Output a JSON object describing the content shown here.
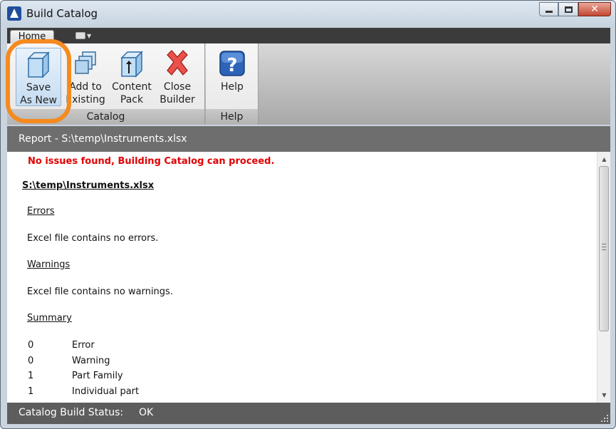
{
  "window": {
    "title": "Build Catalog",
    "controls": {
      "minimize": "minimize",
      "maximize": "maximize",
      "close": "✕"
    }
  },
  "ribbon": {
    "tabs": [
      {
        "label": "Home",
        "active": true
      }
    ],
    "quick_access": {
      "icon": "quick-access-icon"
    },
    "panels": {
      "catalog": {
        "title": "Catalog",
        "buttons": [
          {
            "line1": "Save",
            "line2": "As New",
            "icon": "save-cube-icon",
            "active": true
          },
          {
            "line1": "Add to",
            "line2": "Existing",
            "icon": "add-cubes-icon"
          },
          {
            "line1": "Content",
            "line2": "Pack",
            "icon": "content-pack-icon"
          },
          {
            "line1": "Close",
            "line2": "Builder",
            "icon": "close-red-x-icon"
          }
        ]
      },
      "help": {
        "title": "Help",
        "buttons": [
          {
            "line1": "Help",
            "icon": "help-question-icon"
          }
        ]
      }
    },
    "highlight_color": "#f58a1f"
  },
  "report": {
    "header": "Report - S:\\temp\\Instruments.xlsx",
    "status_message": "No issues found, Building Catalog can proceed.",
    "status_color": "#e00000",
    "file": "S:\\temp\\Instruments.xlsx",
    "errors_heading": "Errors",
    "errors_text": "Excel file contains no errors.",
    "warnings_heading": "Warnings",
    "warnings_text": "Excel file contains no warnings.",
    "summary_heading": "Summary",
    "summary": [
      {
        "count": "0",
        "label": "Error"
      },
      {
        "count": "0",
        "label": "Warning"
      },
      {
        "count": "1",
        "label": "Part Family"
      },
      {
        "count": "1",
        "label": "Individual part"
      }
    ]
  },
  "statusbar": {
    "label": "Catalog Build Status:",
    "value": "OK"
  }
}
